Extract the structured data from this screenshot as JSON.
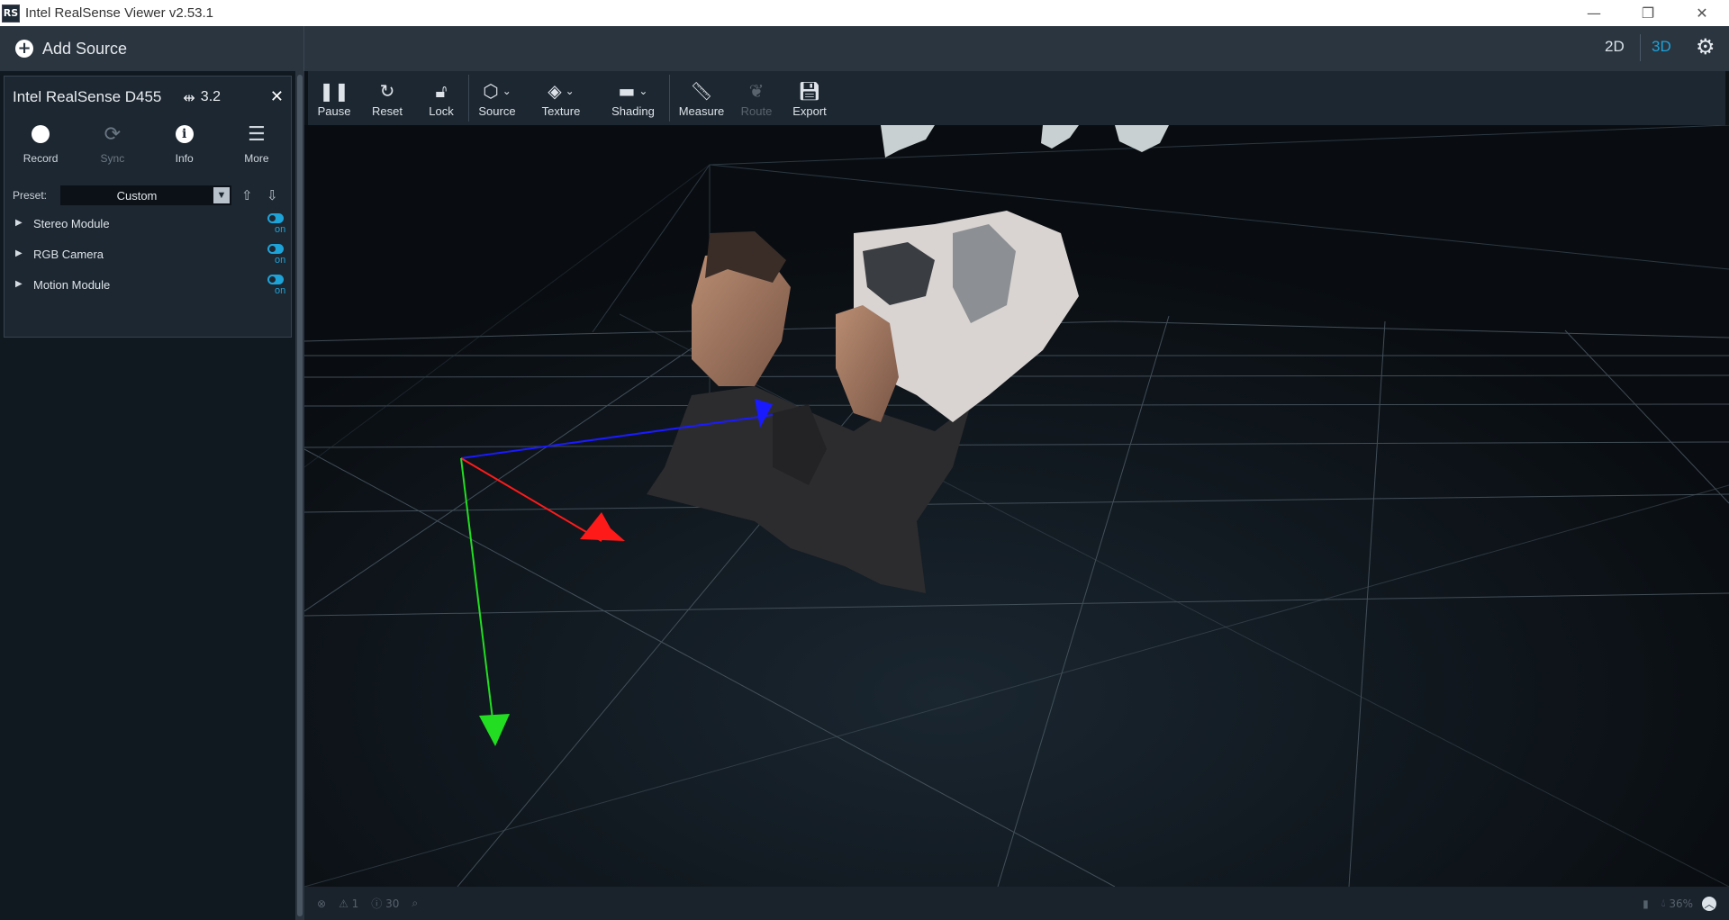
{
  "window": {
    "title": "Intel RealSense Viewer v2.53.1",
    "logo_text": "RS",
    "minimize_glyph": "—",
    "restore_glyph": "❐",
    "close_glyph": "✕"
  },
  "sidebar": {
    "add_source_label": "Add Source",
    "device": {
      "name": "Intel RealSense D455",
      "usb_version": "3.2",
      "actions": [
        {
          "label": "Record",
          "icon": "record-icon",
          "enabled": true
        },
        {
          "label": "Sync",
          "icon": "sync-icon",
          "enabled": false
        },
        {
          "label": "Info",
          "icon": "info-icon",
          "enabled": true
        },
        {
          "label": "More",
          "icon": "menu-icon",
          "enabled": true
        }
      ],
      "preset_label": "Preset:",
      "preset_value": "Custom",
      "modules": [
        {
          "name": "Stereo Module",
          "state": "on"
        },
        {
          "name": "RGB Camera",
          "state": "on"
        },
        {
          "name": "Motion Module",
          "state": "on"
        }
      ]
    }
  },
  "view_mode": {
    "option_2d": "2D",
    "option_3d": "3D",
    "active": "3D"
  },
  "toolbar": {
    "items": [
      {
        "label": "Pause",
        "icon": "pause-icon",
        "enabled": true
      },
      {
        "label": "Reset",
        "icon": "reset-icon",
        "enabled": true
      },
      {
        "label": "Lock",
        "icon": "lock-icon",
        "enabled": true
      },
      {
        "label": "Source",
        "icon": "cube-icon",
        "enabled": true,
        "dropdown": true
      },
      {
        "label": "Texture",
        "icon": "paint-bucket-icon",
        "enabled": true,
        "dropdown": true
      },
      {
        "label": "Shading",
        "icon": "paint-roller-icon",
        "enabled": true,
        "dropdown": true
      },
      {
        "label": "Measure",
        "icon": "ruler-icon",
        "enabled": true
      },
      {
        "label": "Route",
        "icon": "paw-icon",
        "enabled": false
      },
      {
        "label": "Export",
        "icon": "save-icon",
        "enabled": true
      }
    ]
  },
  "statusbar": {
    "warnings": "1",
    "info": "30",
    "memory": "36%"
  },
  "colors": {
    "accent": "#1ea3d9",
    "axis_x": "#ff1a1a",
    "axis_y": "#22dd22",
    "axis_z": "#1a1aff"
  }
}
